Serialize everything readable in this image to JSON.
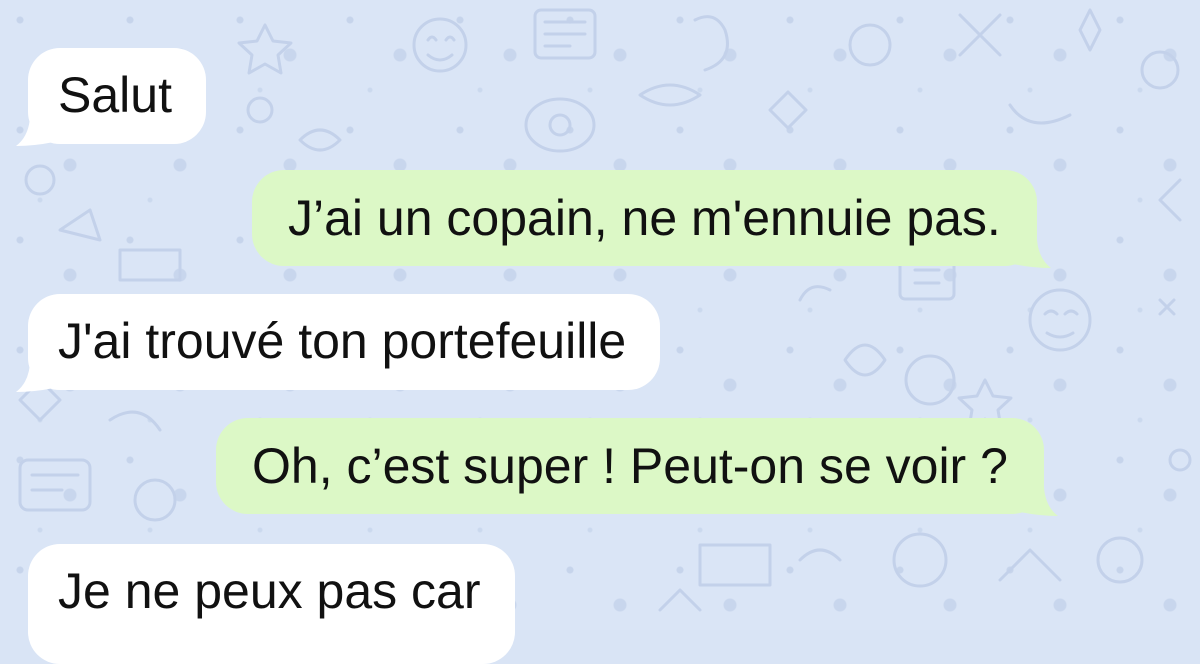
{
  "theme": {
    "background": "#dae5f6",
    "incoming_bubble": "#ffffff",
    "outgoing_bubble": "#dcf8c6",
    "text": "#111111"
  },
  "messages": [
    {
      "direction": "incoming",
      "text": "Salut"
    },
    {
      "direction": "outgoing",
      "text": "J’ai un copain, ne m'ennuie pas."
    },
    {
      "direction": "incoming",
      "text": "J'ai trouvé ton portefeuille"
    },
    {
      "direction": "outgoing",
      "text": "Oh, c’est super ! Peut-on se voir ?"
    },
    {
      "direction": "incoming",
      "text": "Je ne peux pas car"
    }
  ]
}
